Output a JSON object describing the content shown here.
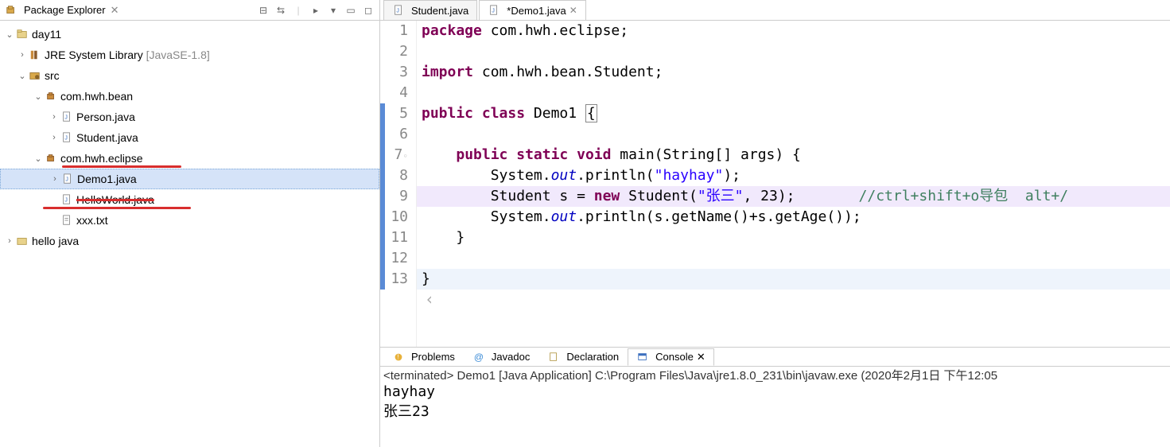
{
  "explorer": {
    "title": "Package Explorer",
    "tree": {
      "project": "day11",
      "jre": {
        "label": "JRE System Library",
        "qualifier": "[JavaSE-1.8]"
      },
      "src": "src",
      "pkg_bean": "com.hwh.bean",
      "person": "Person.java",
      "student": "Student.java",
      "pkg_eclipse": "com.hwh.eclipse",
      "demo1": "Demo1.java",
      "helloworld": "HelloWorld.java",
      "xxx": "xxx.txt",
      "hello_java": "hello java"
    }
  },
  "editor": {
    "tabs": [
      {
        "label": "Student.java",
        "dirty": false,
        "active": false
      },
      {
        "label": "*Demo1.java",
        "dirty": true,
        "active": true
      }
    ],
    "code": {
      "l1_kw1": "package",
      "l1_rest": " com.hwh.eclipse;",
      "l3_kw1": "import",
      "l3_rest": " com.hwh.bean.Student;",
      "l5_kw1": "public",
      "l5_kw2": "class",
      "l5_cls": " Demo1 ",
      "l5_brace": "{",
      "l7_kw1": "public",
      "l7_kw2": "static",
      "l7_kw3": "void",
      "l7_sig": " main(String[] args) {",
      "l8_pre": "        System.",
      "l8_out": "out",
      "l8_mid": ".println(",
      "l8_str": "\"hayhay\"",
      "l8_end": ");",
      "l9_pre": "        Student s = ",
      "l9_new": "new",
      "l9_mid": " Student(",
      "l9_str": "\"张三\"",
      "l9_end": ", 23);",
      "l9_cmt": "//ctrl+shift+o导包  alt+/",
      "l10_pre": "        System.",
      "l10_out": "out",
      "l10_end": ".println(s.getName()+s.getAge());",
      "l11": "    }",
      "l13": "}"
    }
  },
  "bottom": {
    "tabs": {
      "problems": "Problems",
      "javadoc": "Javadoc",
      "declaration": "Declaration",
      "console": "Console"
    },
    "status": "<terminated> Demo1 [Java Application] C:\\Program Files\\Java\\jre1.8.0_231\\bin\\javaw.exe (2020年2月1日 下午12:05",
    "output": {
      "l1": "hayhay",
      "l2": "张三23"
    }
  }
}
